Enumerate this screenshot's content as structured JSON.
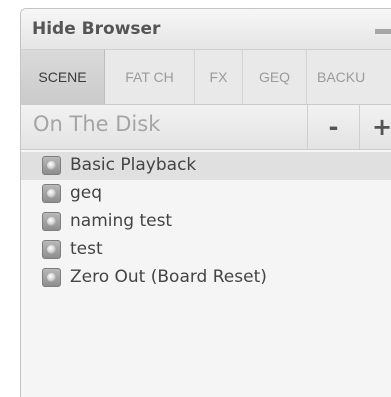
{
  "window": {
    "title": "Hide Browser"
  },
  "tabs": [
    {
      "label": "SCENE",
      "active": true
    },
    {
      "label": "FAT CH",
      "active": false
    },
    {
      "label": "FX",
      "active": false
    },
    {
      "label": "GEQ",
      "active": false
    },
    {
      "label": "BACKU",
      "active": false
    }
  ],
  "section": {
    "title": "On The Disk",
    "minus_label": "-",
    "plus_label": "+"
  },
  "scenes": [
    {
      "label": "Basic Playback",
      "selected": true
    },
    {
      "label": "geq",
      "selected": false
    },
    {
      "label": "naming test",
      "selected": false
    },
    {
      "label": "test",
      "selected": false
    },
    {
      "label": "Zero Out (Board Reset)",
      "selected": false
    }
  ],
  "icons": {
    "scene": "scene-file-icon",
    "minimize": "minimize-icon"
  },
  "colors": {
    "panel_bg": "#f3f3f3",
    "active_tab": "#cbcbcb",
    "selected_row": "#e0e0e0"
  }
}
